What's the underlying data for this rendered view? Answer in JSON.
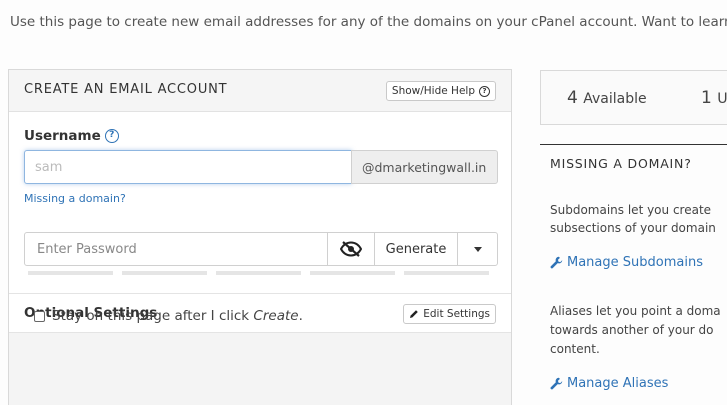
{
  "intro_text": "Use this page to create new email addresses for any of the domains on your cPanel account. Want to learn",
  "create_panel": {
    "title": "CREATE AN EMAIL ACCOUNT",
    "help_button": "Show/Hide Help",
    "username_label": "Username",
    "username_value": "sam",
    "domain_suffix": "@dmarketingwall.in",
    "missing_domain_link": "Missing a domain?",
    "password_placeholder": "Enter Password",
    "generate_label": "Generate",
    "optional_title": "Optional Settings",
    "edit_settings_label": "Edit Settings",
    "stay_text_prefix": "Stay on this page after I click ",
    "stay_text_emphasis": "Create",
    "stay_text_suffix": "."
  },
  "stats": {
    "available_count": "4",
    "available_label": "Available",
    "used_count": "1",
    "used_label": "U"
  },
  "sidebar": {
    "missing_title": "MISSING A DOMAIN?",
    "subdomains_text_1": "Subdomains let you create",
    "subdomains_text_2": "subsections of your domain",
    "manage_subdomains": "Manage Subdomains",
    "aliases_text_1": "Aliases let you point a doma",
    "aliases_text_2": "towards another of your do",
    "aliases_text_3": "content.",
    "manage_aliases": "Manage Aliases"
  },
  "colors": {
    "link": "#2f73b6",
    "focus_border": "#8fb6e0",
    "header_bg": "#f5f5f5"
  },
  "icons": [
    "question-circle-icon",
    "eye-slash-icon",
    "caret-down-icon",
    "pencil-icon",
    "wrench-icon"
  ]
}
